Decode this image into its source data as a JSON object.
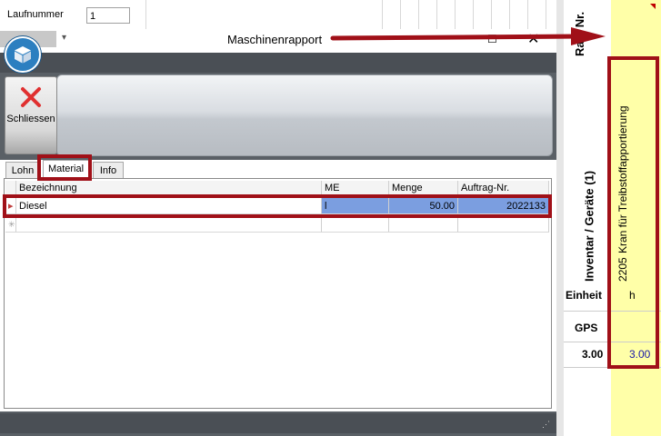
{
  "background_sheet": {
    "laufnummer_label": "Laufnummer",
    "laufnummer_value": "1"
  },
  "right_sheet": {
    "rap_nr_header": "Rap. Nr.",
    "inventar_header": "Inventar / Geräte (1)",
    "equipment_number": "2205",
    "equipment_name": "Kran für Treibstoffapportierung",
    "einheit_label": "Einheit",
    "einheit_value": "h",
    "gps_label": "GPS",
    "total_left": "3.00",
    "total_right": "3.00"
  },
  "window": {
    "title": "Maschinenrapport",
    "quick_access_arrow": "▾",
    "maximize_glyph": "☐",
    "close_glyph": "✕",
    "app_icon": "cube-icon",
    "ribbon": {
      "close_button_label": "Schliessen",
      "close_button_icon": "red-x-icon"
    },
    "tabs": [
      {
        "label": "Lohn",
        "active": false
      },
      {
        "label": "Material",
        "active": true
      },
      {
        "label": "Info",
        "active": false
      }
    ],
    "grid": {
      "columns": [
        "Bezeichnung",
        "ME",
        "Menge",
        "Auftrag-Nr."
      ],
      "rows": [
        {
          "bezeichnung": "Diesel",
          "me": "l",
          "menge": "50.00",
          "auftrag_nr": "2022133"
        }
      ]
    }
  },
  "colors": {
    "annotation_red": "#a01018",
    "yellow_column": "#ffffa8",
    "selection_blue": "#7b9ee0",
    "value_blue": "#1a1aa8"
  }
}
